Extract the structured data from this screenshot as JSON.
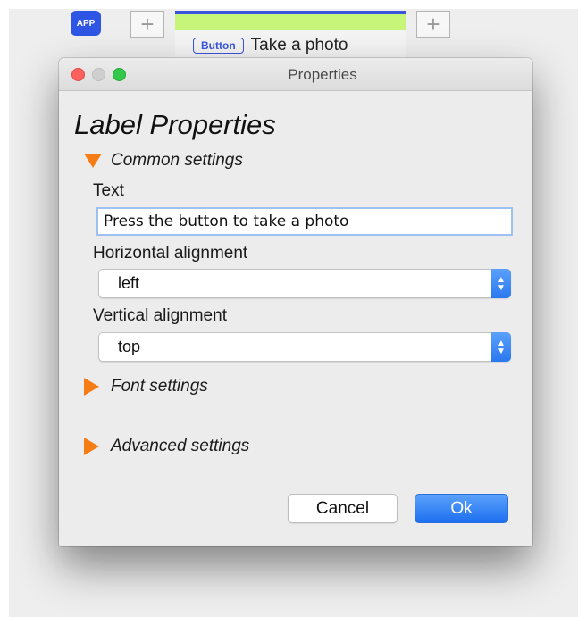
{
  "background_app": {
    "app_icon_label": "APP",
    "button_chip_label": "Button",
    "button_caption": "Take a photo"
  },
  "dialog": {
    "window_title": "Properties",
    "heading": "Label Properties",
    "sections": {
      "common": "Common settings",
      "font": "Font settings",
      "advanced": "Advanced settings"
    },
    "text_field": {
      "label": "Text",
      "value": "Press the button to take a photo"
    },
    "horizontal_alignment": {
      "label": "Horizontal alignment",
      "value": "left"
    },
    "vertical_alignment": {
      "label": "Vertical alignment",
      "value": "top"
    },
    "buttons": {
      "cancel": "Cancel",
      "ok": "Ok"
    }
  },
  "colors": {
    "accent_blue": "#2a78ef",
    "disclosure_orange": "#f67d16",
    "close_red": "#fc615d",
    "zoom_green": "#34c84a"
  }
}
